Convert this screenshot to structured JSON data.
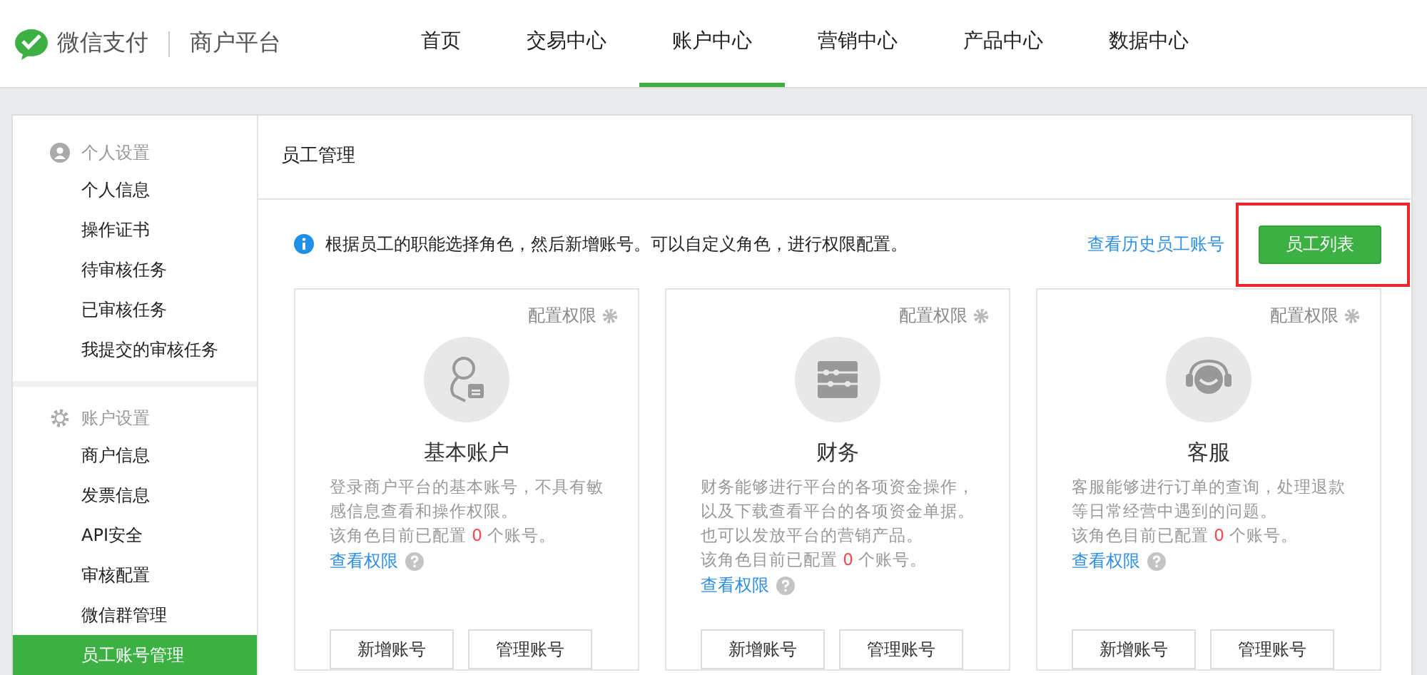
{
  "header": {
    "brand": "微信支付",
    "product": "商户平台",
    "nav": [
      {
        "label": "首页",
        "selected": false
      },
      {
        "label": "交易中心",
        "selected": false
      },
      {
        "label": "账户中心",
        "selected": true
      },
      {
        "label": "营销中心",
        "selected": false
      },
      {
        "label": "产品中心",
        "selected": false
      },
      {
        "label": "数据中心",
        "selected": false
      }
    ]
  },
  "sidebar": {
    "groups": [
      {
        "title": "个人设置",
        "kind": "person",
        "items": [
          {
            "label": "个人信息",
            "selected": false
          },
          {
            "label": "操作证书",
            "selected": false
          },
          {
            "label": "待审核任务",
            "selected": false
          },
          {
            "label": "已审核任务",
            "selected": false
          },
          {
            "label": "我提交的审核任务",
            "selected": false
          }
        ]
      },
      {
        "title": "账户设置",
        "kind": "gear",
        "items": [
          {
            "label": "商户信息",
            "selected": false
          },
          {
            "label": "发票信息",
            "selected": false
          },
          {
            "label": "API安全",
            "selected": false
          },
          {
            "label": "审核配置",
            "selected": false
          },
          {
            "label": "微信群管理",
            "selected": false
          },
          {
            "label": "员工账号管理",
            "selected": true
          }
        ]
      }
    ]
  },
  "main": {
    "title": "员工管理",
    "notice": "根据员工的职能选择角色，然后新增账号。可以自定义角色，进行权限配置。",
    "history_link": "查看历史员工账号",
    "list_button": {
      "label": "员工列表",
      "highlighted": true
    },
    "roles": [
      {
        "kind": "basic",
        "config": "配置权限",
        "name": "基本账户",
        "description": [
          "登录商户平台的基本账号，不具有敏感信息查看和操作权限。"
        ],
        "count_prefix": "该角色目前已配置",
        "count": "0",
        "count_suffix": "个账号。",
        "permissions_link": "查看权限",
        "buttons": [
          "新增账号",
          "管理账号"
        ]
      },
      {
        "kind": "finance",
        "config": "配置权限",
        "name": "财务",
        "description": [
          "财务能够进行平台的各项资金操作，以及下载查看平台的各项资金单据。",
          "也可以发放平台的营销产品。"
        ],
        "count_prefix": "该角色目前已配置",
        "count": "0",
        "count_suffix": "个账号。",
        "permissions_link": "查看权限",
        "buttons": [
          "新增账号",
          "管理账号"
        ]
      },
      {
        "kind": "service",
        "config": "配置权限",
        "name": "客服",
        "description": [
          "客服能够进行订单的查询，处理退款等日常经营中遇到的问题。"
        ],
        "count_prefix": "该角色目前已配置",
        "count": "0",
        "count_suffix": "个账号。",
        "permissions_link": "查看权限",
        "buttons": [
          "新增账号",
          "管理账号"
        ]
      }
    ]
  }
}
